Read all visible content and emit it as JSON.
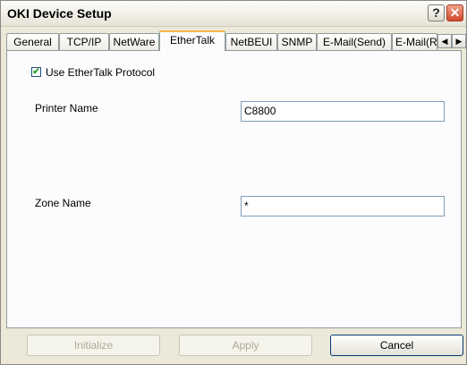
{
  "window": {
    "title": "OKI Device Setup"
  },
  "titlebar": {
    "help_label": "?",
    "close_label": "✕"
  },
  "tabs": [
    {
      "label": "General"
    },
    {
      "label": "TCP/IP"
    },
    {
      "label": "NetWare"
    },
    {
      "label": "EtherTalk",
      "active": true
    },
    {
      "label": "NetBEUI"
    },
    {
      "label": "SNMP"
    },
    {
      "label": "E-Mail(Send)"
    },
    {
      "label": "E-Mail(R"
    }
  ],
  "tab_scroll": {
    "left": "◀",
    "right": "▶"
  },
  "ethertalk": {
    "use_protocol_label": "Use EtherTalk Protocol",
    "use_protocol_checked": true,
    "check_mark": "✔",
    "printer_name_label": "Printer Name",
    "printer_name_value": "C8800",
    "zone_name_label": "Zone Name",
    "zone_name_value": "*"
  },
  "buttons": {
    "initialize": "Initialize",
    "apply": "Apply",
    "cancel": "Cancel"
  }
}
